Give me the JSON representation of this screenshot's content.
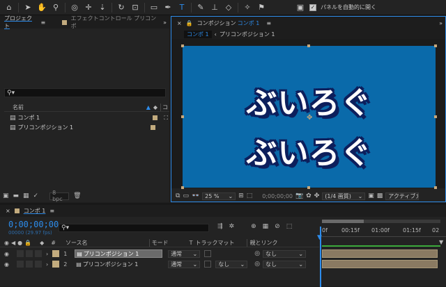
{
  "toolbar": {
    "auto_open_label": "パネルを自動的に開く"
  },
  "project_panel": {
    "tab_label": "プロジェクト",
    "effects_tab_label": "エフェクトコントロール プリコンポ",
    "name_header": "名前",
    "items": [
      {
        "name": "コンポ 1"
      },
      {
        "name": "プリコンポジション 1"
      }
    ],
    "bpc": "8 bpc"
  },
  "comp_panel": {
    "tab_label": "コンポジション",
    "tab_comp_name": "コンポ 1",
    "breadcrumb_active": "コンポ 1",
    "breadcrumb_next": "プリコンポジション 1",
    "text_line_1": "ぶいろぐ",
    "text_line_2": "ぶいろぐ",
    "canvas_color": "#0a6aaa",
    "zoom": "25 %",
    "timecode": "0;00;00;00",
    "resolution": "(1/4 画質)",
    "camera": "アクティブカメ"
  },
  "timeline": {
    "tab_label": "コンポ 1",
    "timecode": "0;00;00;00",
    "frame_info": "00000 (29.97 fps)",
    "ruler": [
      "0f",
      "00:15f",
      "01:00f",
      "01:15f",
      "02"
    ],
    "headers": {
      "num": "#",
      "source": "ソース名",
      "mode": "モード",
      "t": "T",
      "trackmatte": "トラックマット",
      "parent": "親とリンク"
    },
    "layers": [
      {
        "num": "1",
        "name": "プリコンポジション 1",
        "mode": "通常",
        "matte": "",
        "parent": "なし"
      },
      {
        "num": "2",
        "name": "プリコンポジション 1",
        "mode": "通常",
        "matte": "なし",
        "parent": "なし"
      }
    ]
  }
}
